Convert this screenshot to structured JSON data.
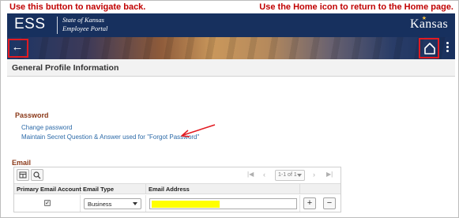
{
  "annotations": {
    "left": "Use this button to navigate back.",
    "right": "Use the Home icon to return to the Home page."
  },
  "banner": {
    "app_short": "ESS",
    "subtitle_line1": "State of Kansas",
    "subtitle_line2": "Employee Portal",
    "logo_text": "Kansas"
  },
  "navbar": {
    "back_glyph": "←",
    "back_icon": "arrow-left-icon",
    "home_icon": "home-icon",
    "menu_icon": "kebab-menu-icon"
  },
  "page": {
    "title": "General Profile Information"
  },
  "password": {
    "title": "Password",
    "change_link": "Change password",
    "secret_link": "Maintain Secret Question & Answer used for \"Forgot Password\""
  },
  "email": {
    "title": "Email",
    "pager": {
      "first": "|◀",
      "prev": "‹",
      "range": "1-1 of 1",
      "next": "›",
      "last": "▶|"
    },
    "columns": [
      "Primary Email Account",
      "Email Type",
      "Email Address",
      ""
    ],
    "rows": [
      {
        "primary": true,
        "primary_mark": "✓",
        "type": "Business",
        "address": ""
      }
    ],
    "add_label": "+",
    "delete_label": "−"
  },
  "colors": {
    "banner": "#17305e",
    "annotation": "#c00000",
    "callout_box": "#e21b22",
    "section_title": "#8b3a1a",
    "link": "#2c6aa8",
    "redaction": "#ffff00"
  }
}
